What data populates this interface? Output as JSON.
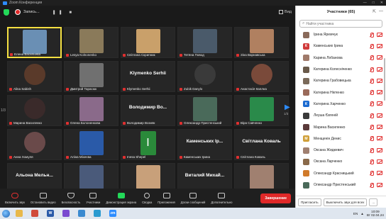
{
  "window": {
    "title": "Zoom Конференция",
    "controls": [
      "—",
      "□",
      "✕"
    ]
  },
  "topbar": {
    "recording_label": "Запись...",
    "recording_controls": "❚❚ ■",
    "view_label": "Вид"
  },
  "pager": {
    "left": "1/3",
    "right": "1/3"
  },
  "tiles": [
    {
      "name": "Елена Васильева",
      "kind": "photo",
      "color": "#6a8fb4",
      "active": true,
      "muted": true
    },
    {
      "name": "Lesya Kolnonenko",
      "kind": "photo",
      "color": "#8a7a5a",
      "active": false,
      "muted": true
    },
    {
      "name": "Світлана Скрипник",
      "kind": "photo",
      "color": "#c9a06a",
      "active": false,
      "muted": true
    },
    {
      "name": "Тетяна Повод",
      "kind": "photo",
      "color": "#4a5a6a",
      "active": false,
      "muted": true
    },
    {
      "name": "Зіна Варнавська",
      "kind": "photo",
      "color": "#b08060",
      "active": false,
      "muted": true
    },
    {
      "name": "Alina Sabish",
      "kind": "avatar",
      "color": "#5a3a2a",
      "active": false,
      "muted": true
    },
    {
      "name": "Дмитрий Тарасюк",
      "kind": "photo",
      "color": "#707070",
      "active": false,
      "muted": true
    },
    {
      "name": "Klymenko Serhii",
      "big": "Klymenko Serhii",
      "kind": "text",
      "active": false,
      "muted": true
    },
    {
      "name": "Zubik Danylo",
      "kind": "avatar",
      "color": "#3a3a3a",
      "active": false,
      "muted": true
    },
    {
      "name": "Анастасія Каплна",
      "kind": "avatar",
      "color": "#7a4a3a",
      "active": false,
      "muted": true
    },
    {
      "name": "Марина Василенко",
      "kind": "avatar",
      "color": "#3a2a2a",
      "active": false,
      "muted": true
    },
    {
      "name": "Олена Болоненкова",
      "kind": "photo",
      "color": "#8a6a8a",
      "active": false,
      "muted": true
    },
    {
      "name": "Володимир Возняк",
      "big": "Володимир Во...",
      "kind": "text",
      "active": false,
      "muted": true
    },
    {
      "name": "Олександр Пристенський",
      "kind": "photo",
      "color": "#4a6a5a",
      "active": false,
      "muted": true
    },
    {
      "name": "Віра Савченко",
      "kind": "photo",
      "color": "#2a8a4a",
      "active": false,
      "muted": true
    },
    {
      "name": "Анна Хомуля",
      "kind": "avatar",
      "color": "#6a4a4a",
      "active": false,
      "muted": true
    },
    {
      "name": "Аліна Міхеєва",
      "kind": "photo",
      "color": "#2a5aa8",
      "active": false,
      "muted": true
    },
    {
      "name": "Inesa Shepel",
      "kind": "letter",
      "letter": "I",
      "color": "#2a8a3a",
      "active": false,
      "muted": true
    },
    {
      "name": "Каменських Ірина",
      "big": "Каменських Ір...",
      "kind": "text",
      "active": false,
      "muted": true
    },
    {
      "name": "Світлана Коваль",
      "big": "Світлана Коваль",
      "kind": "text",
      "active": false,
      "muted": true
    },
    {
      "name": "Альона Мельниченко",
      "big": "Альона Мельн...",
      "kind": "text",
      "active": false,
      "muted": true
    },
    {
      "name": "Kvasnikov Illya",
      "kind": "photo",
      "color": "#4a5a7a",
      "active": false,
      "muted": true
    },
    {
      "name": "Алла Харченко",
      "kind": "photo",
      "color": "#c8a07a",
      "active": false,
      "muted": true
    },
    {
      "name": "Виталий Михайленко",
      "big": "Виталий Михай...",
      "kind": "text",
      "active": false,
      "muted": true
    },
    {
      "name": "Оксана Жидкевич",
      "kind": "photo",
      "color": "#a08070",
      "active": false,
      "muted": true
    }
  ],
  "toolbar": {
    "items": [
      {
        "label": "Включить звук",
        "icon": "mic-off"
      },
      {
        "label": "Остановить видео",
        "icon": "video"
      },
      {
        "label": "Безопасность",
        "icon": "shield"
      },
      {
        "label": "Участники",
        "icon": "participants"
      },
      {
        "label": "Демонстрация экрана",
        "icon": "share"
      },
      {
        "label": "Сводка",
        "icon": "summary"
      },
      {
        "label": "Приложения",
        "icon": "apps"
      },
      {
        "label": "Доски сообщений",
        "icon": "whiteboard"
      },
      {
        "label": "Дополнительно",
        "icon": "more"
      }
    ],
    "end_label": "Завершение"
  },
  "panel": {
    "title": "Участники (65)",
    "search_placeholder": "Найти участника",
    "participants": [
      {
        "name": "Ірина Яремчук",
        "initial": "",
        "color": "#8a6a5a"
      },
      {
        "name": "Каменських Ірина",
        "initial": "К",
        "color": "#d03a3a"
      },
      {
        "name": "Карина Лобанова",
        "initial": "",
        "color": "#a07a6a"
      },
      {
        "name": "Катерина Колесніченко",
        "initial": "",
        "color": "#6a5a4a"
      },
      {
        "name": "Катерина Грабовецька",
        "initial": "",
        "color": "#7a6a5a"
      },
      {
        "name": "Катерина Ніктенко",
        "initial": "",
        "color": "#9a6a5a"
      },
      {
        "name": "Катерина Харченко",
        "initial": "К",
        "color": "#1a6ad0"
      },
      {
        "name": "Леуша Євгеній",
        "initial": "",
        "color": "#3a3a3a"
      },
      {
        "name": "Марина Василенко",
        "initial": "",
        "color": "#5a3a3a"
      },
      {
        "name": "Менщенін Денис",
        "initial": "М",
        "color": "#d0a03a"
      },
      {
        "name": "Оксана Жидкевич",
        "initial": "",
        "color": "#a08070"
      },
      {
        "name": "Оксана Ларченко",
        "initial": "",
        "color": "#8a6a4a"
      },
      {
        "name": "Олександр Красницький",
        "initial": "",
        "color": "#d07a2a"
      },
      {
        "name": "Олександр Пристенський",
        "initial": "",
        "color": "#4a6a5a"
      }
    ],
    "invite_label": "Пригласить",
    "mute_all_label": "Выключить звук для всех",
    "more_label": "..."
  },
  "taskbar": {
    "apps": [
      {
        "name": "explorer",
        "label": "",
        "color": "#e8b84a"
      },
      {
        "name": "chrome",
        "label": "",
        "color": "#d04a3a"
      },
      {
        "name": "word",
        "label": "W",
        "color": "#2a5aa8"
      },
      {
        "name": "viber",
        "label": "",
        "color": "#7a4ad0"
      },
      {
        "name": "files",
        "label": "",
        "color": "#3a8ad0"
      },
      {
        "name": "edge",
        "label": "",
        "color": "#2a9ad0"
      },
      {
        "name": "zoom",
        "label": "zm",
        "color": "#2d8cff"
      }
    ],
    "lang": "EN",
    "time": "10:09",
    "date": "Вт 02.04.24"
  }
}
